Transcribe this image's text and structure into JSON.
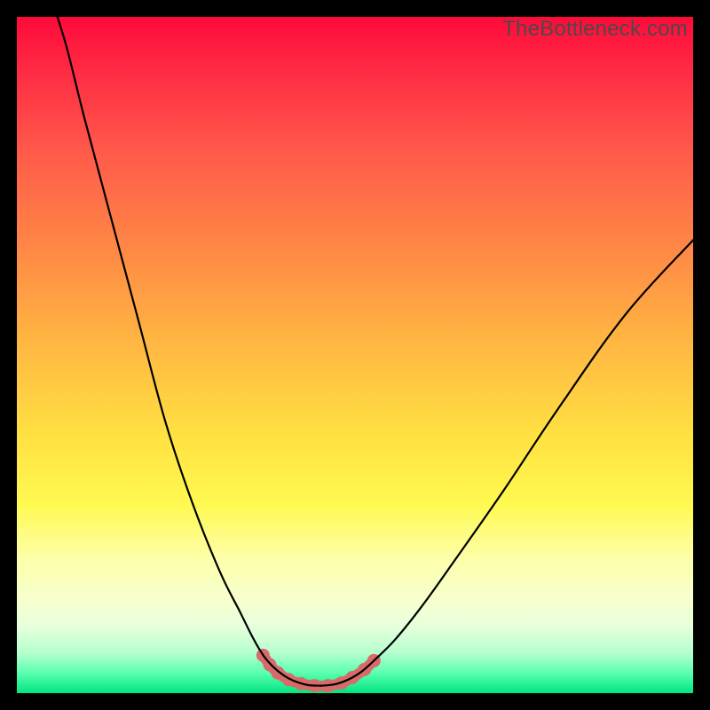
{
  "watermark": "TheBottleneck.com",
  "chart_data": {
    "type": "line",
    "title": "",
    "xlabel": "",
    "ylabel": "",
    "xlim": [
      0,
      100
    ],
    "ylim": [
      0,
      100
    ],
    "grid": false,
    "legend": false,
    "left_curve_points": [
      {
        "x": 6.0,
        "y": 100.0
      },
      {
        "x": 7.5,
        "y": 95.0
      },
      {
        "x": 10.0,
        "y": 85.0
      },
      {
        "x": 14.0,
        "y": 70.0
      },
      {
        "x": 18.0,
        "y": 55.0
      },
      {
        "x": 22.0,
        "y": 40.0
      },
      {
        "x": 26.0,
        "y": 28.0
      },
      {
        "x": 30.0,
        "y": 18.0
      },
      {
        "x": 33.0,
        "y": 12.0
      },
      {
        "x": 35.0,
        "y": 8.0
      },
      {
        "x": 36.5,
        "y": 5.5
      },
      {
        "x": 38.0,
        "y": 3.8
      },
      {
        "x": 39.5,
        "y": 2.6
      },
      {
        "x": 41.0,
        "y": 1.8
      },
      {
        "x": 43.0,
        "y": 1.2
      },
      {
        "x": 45.0,
        "y": 1.1
      }
    ],
    "right_curve_points": [
      {
        "x": 45.0,
        "y": 1.1
      },
      {
        "x": 47.0,
        "y": 1.3
      },
      {
        "x": 49.0,
        "y": 2.0
      },
      {
        "x": 51.0,
        "y": 3.2
      },
      {
        "x": 53.0,
        "y": 5.0
      },
      {
        "x": 56.0,
        "y": 8.0
      },
      {
        "x": 60.0,
        "y": 13.0
      },
      {
        "x": 65.0,
        "y": 20.0
      },
      {
        "x": 72.0,
        "y": 30.0
      },
      {
        "x": 80.0,
        "y": 42.0
      },
      {
        "x": 90.0,
        "y": 56.0
      },
      {
        "x": 100.0,
        "y": 67.0
      }
    ],
    "highlight_points": [
      {
        "x": 36.4,
        "y": 5.6
      },
      {
        "x": 37.4,
        "y": 4.2
      },
      {
        "x": 38.6,
        "y": 3.0
      },
      {
        "x": 40.2,
        "y": 2.0
      },
      {
        "x": 42.0,
        "y": 1.4
      },
      {
        "x": 44.0,
        "y": 1.1
      },
      {
        "x": 46.0,
        "y": 1.1
      },
      {
        "x": 48.0,
        "y": 1.5
      },
      {
        "x": 49.6,
        "y": 2.3
      },
      {
        "x": 51.4,
        "y": 3.5
      },
      {
        "x": 52.8,
        "y": 4.8
      }
    ],
    "gradient_stops": [
      {
        "pos": 0,
        "color": "#ff0a3a"
      },
      {
        "pos": 20,
        "color": "#ff5a4a"
      },
      {
        "pos": 48,
        "color": "#ffb642"
      },
      {
        "pos": 72,
        "color": "#fff950"
      },
      {
        "pos": 90,
        "color": "#e8ffdc"
      },
      {
        "pos": 100,
        "color": "#00e580"
      }
    ]
  }
}
